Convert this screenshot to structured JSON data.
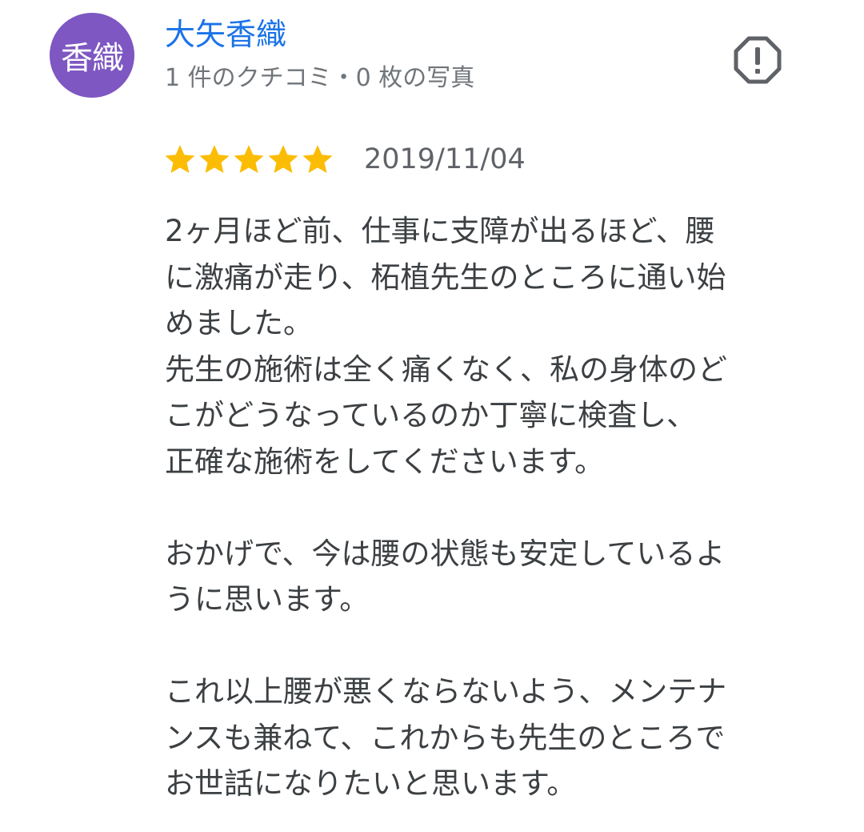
{
  "reviewer": {
    "avatar_text": "香織",
    "avatar_color": "#7e57c2",
    "name": "大矢香織",
    "meta": "1 件のクチコミ・0 枚の写真"
  },
  "report_icon": "report-flag-icon",
  "review": {
    "rating": 5,
    "max_rating": 5,
    "star_color": "#fbbc04",
    "date": "2019/11/04",
    "lines": [
      "2ヶ月ほど前、仕事に支障が出るほど、腰",
      "に激痛が走り、柘植先生のところに通い始",
      "めました。",
      "先生の施術は全く痛くなく、私の身体のど",
      "こがどうなっているのか丁寧に検査し、",
      "正確な施術をしてくださいます。",
      "",
      "おかげで、今は腰の状態も安定しているよ",
      "うに思います。",
      "",
      "これ以上腰が悪くならないよう、メンテナ",
      "ンスも兼ねて、これからも先生のところで",
      "お世話になりたいと思います。"
    ]
  },
  "colors": {
    "name_link": "#1a73e8",
    "meta_text": "#70757a",
    "body_text": "#3c4043"
  }
}
